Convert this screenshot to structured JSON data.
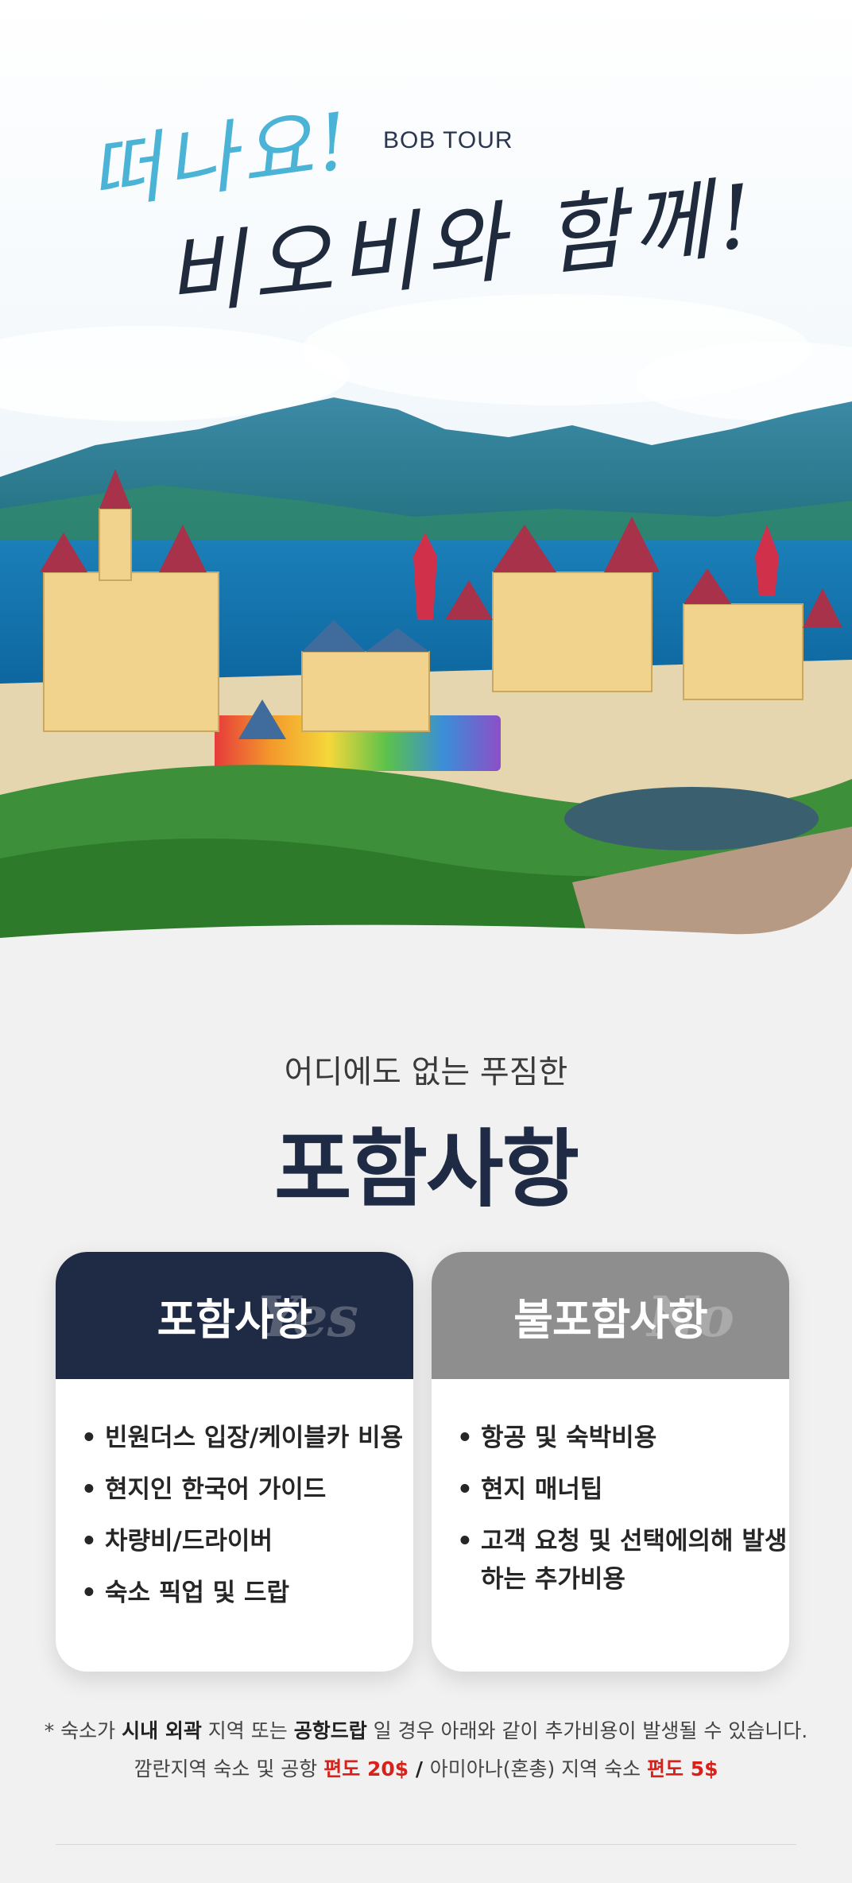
{
  "hero": {
    "script_line1": "떠나요!",
    "brand": "BOB TOUR",
    "script_line2": "비오비와 함께!"
  },
  "section": {
    "subtitle": "어디에도 없는 푸짐한",
    "title": "포함사항"
  },
  "included": {
    "title": "포함사항",
    "ghost": "Yes",
    "items": [
      "빈원더스 입장/케이블카 비용",
      "현지인 한국어 가이드",
      "차량비/드라이버",
      "숙소 픽업 및 드랍"
    ]
  },
  "excluded": {
    "title": "불포함사항",
    "ghost": "No",
    "items": [
      "항공 및 숙박비용",
      "현지 매너팁",
      "고객 요청 및 선택에의해 발생하는 추가비용"
    ]
  },
  "notes": {
    "line1_a": "* 숙소가 ",
    "line1_b": "시내 외곽",
    "line1_c": " 지역 또는 ",
    "line1_d": "공항드랍",
    "line1_e": " 일 경우 아래와 같이 추가비용이 발생될 수 있습니다.",
    "line2_a": "깜란지역 숙소 및 공항 ",
    "line2_b": "편도 20$",
    "line2_c": " / ",
    "line2_d": "아미아나(혼총) 지역 숙소 ",
    "line2_e": "편도 5$"
  },
  "colors": {
    "navy": "#1f2a44",
    "gray": "#8e8e8e",
    "red": "#d8211a",
    "sea": "#1b7fb8"
  }
}
